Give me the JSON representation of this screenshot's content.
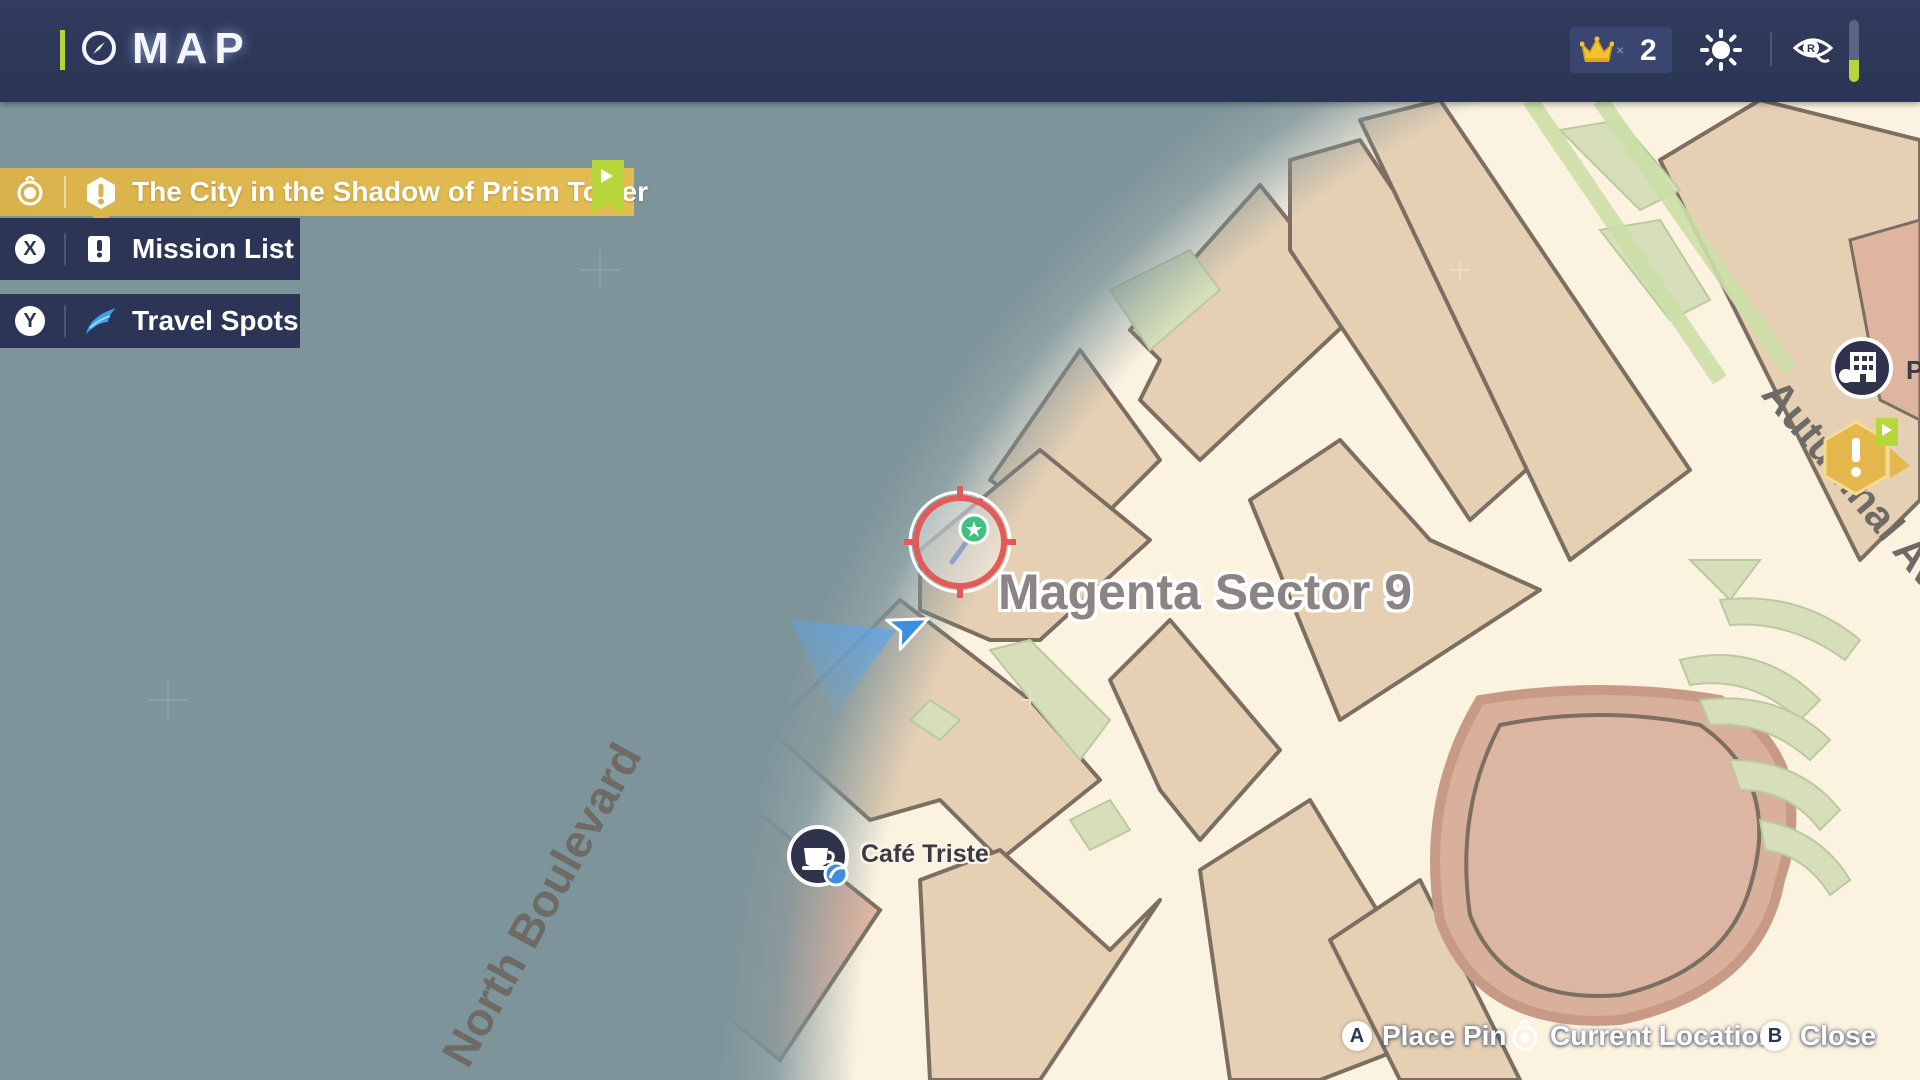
{
  "header": {
    "title": "MAP",
    "crown_multiplier": "×",
    "crown_count": "2",
    "battery_level": 0.35,
    "icons": [
      "compass-icon",
      "crown-icon",
      "sun-icon",
      "map-toggle-icon"
    ]
  },
  "panel": {
    "active_mission": {
      "button": "R",
      "label": "The City in the Shadow of Prism Tower",
      "icon": "mission-exclamation-icon"
    },
    "mission_list": {
      "button": "X",
      "label": "Mission List",
      "icon": "mission-list-icon"
    },
    "travel_spots": {
      "button": "Y",
      "label": "Travel Spots",
      "icon": "wing-icon"
    }
  },
  "map": {
    "district": "Magenta Sector 9",
    "streets": [
      "North Boulevard",
      "Autumnal Ave"
    ],
    "pois": [
      {
        "name": "Café Triste",
        "icon": "cafe-icon"
      },
      {
        "name": "P",
        "icon": "building-icon"
      }
    ],
    "markers": [
      "pin-target-icon",
      "player-arrow-icon",
      "mission-marker-icon"
    ]
  },
  "controls": {
    "place_pin": {
      "button": "A",
      "label": "Place Pin"
    },
    "current_location": {
      "button": "L",
      "label": "Current Location"
    },
    "close": {
      "button": "B",
      "label": "Close"
    }
  },
  "colors": {
    "header_bg": "#2b3555",
    "accent_green": "#b6d63c",
    "mission_gold": "#d9b24c",
    "map_block": "#e6d0b4",
    "map_road": "#fdf6e4",
    "water": "#7d949b",
    "pin_red": "#e35a5a",
    "player_blue": "#3c8ee0"
  }
}
